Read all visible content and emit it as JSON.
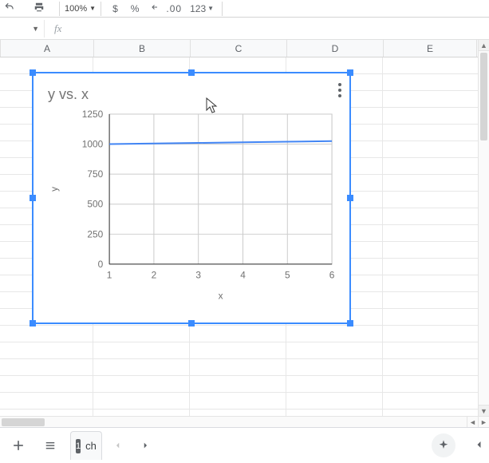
{
  "toolbar": {
    "zoom": "100%",
    "decimals": ".00",
    "num_format": "123"
  },
  "columns": [
    "A",
    "B",
    "C",
    "D",
    "E"
  ],
  "chart_data": {
    "type": "line",
    "title": "y vs. x",
    "xlabel": "x",
    "ylabel": "y",
    "x": [
      1,
      2,
      3,
      4,
      5,
      6
    ],
    "y": [
      1000,
      1005,
      1010,
      1015,
      1020,
      1025
    ],
    "x_ticks": [
      1,
      2,
      3,
      4,
      5,
      6
    ],
    "y_ticks": [
      0,
      250,
      500,
      750,
      1000,
      1250
    ],
    "xlim": [
      1,
      6
    ],
    "ylim": [
      0,
      1250
    ]
  },
  "sheetbar": {
    "tab_badge": "1",
    "tab_label": "ch"
  }
}
